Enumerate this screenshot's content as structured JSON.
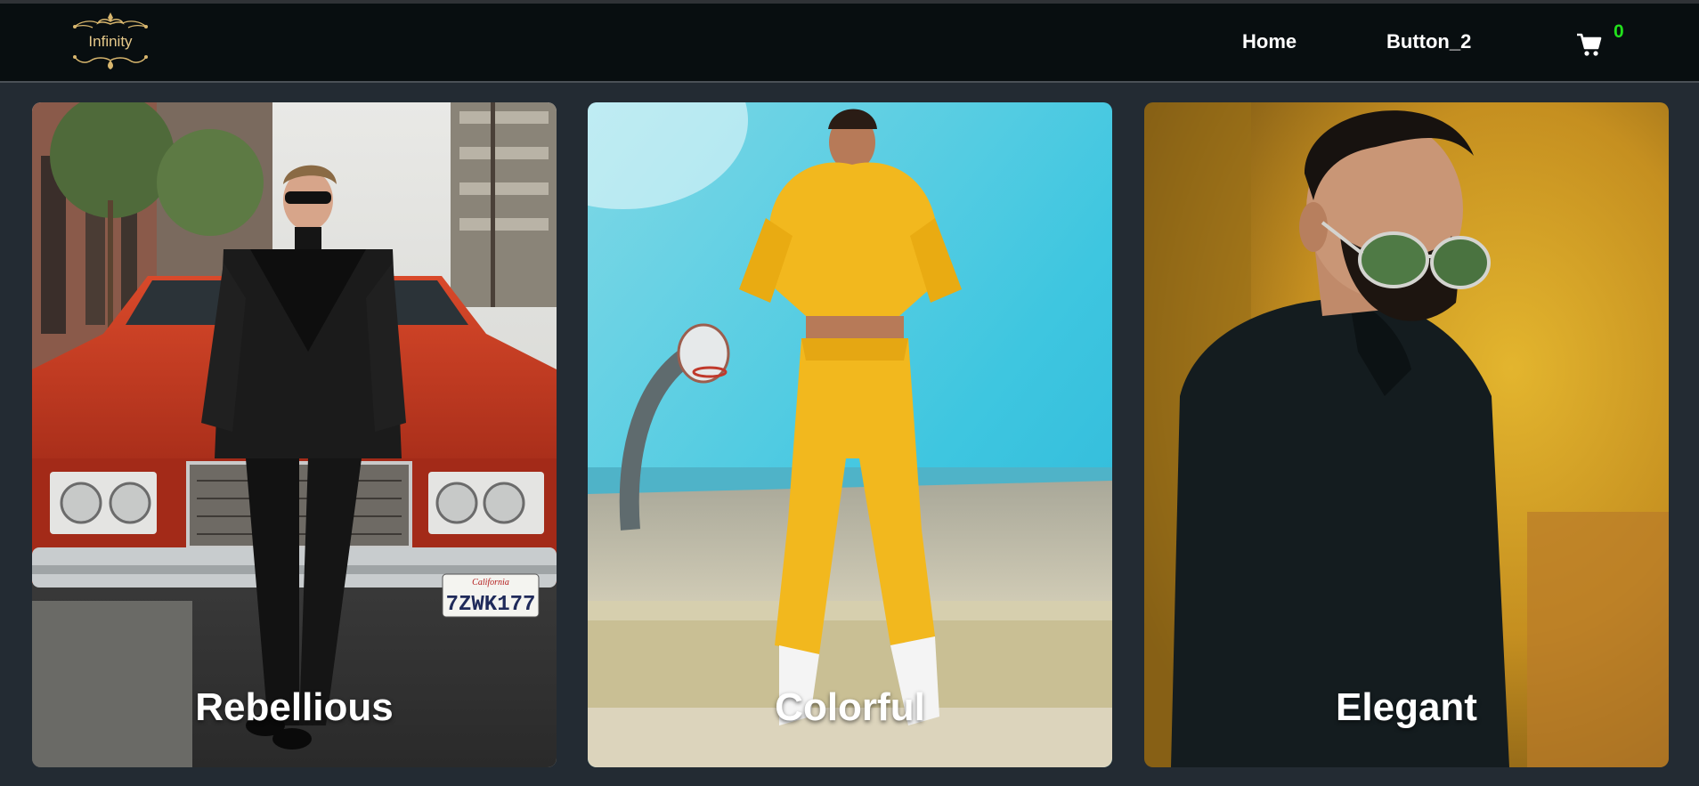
{
  "logo": {
    "text": "Infinity"
  },
  "nav": {
    "home_label": "Home",
    "button2_label": "Button_2",
    "cart_icon": "cart-icon",
    "cart_count": "0"
  },
  "cards": [
    {
      "label": "Rebellious"
    },
    {
      "label": "Colorful"
    },
    {
      "label": "Elegant"
    }
  ],
  "card1_plate": {
    "state": "California",
    "number": "7ZWK177"
  },
  "colors": {
    "navbar_bg": "#080e10",
    "page_bg": "#232b33",
    "cart_count": "#22e01c",
    "logo_gold": "#e6c98a"
  }
}
